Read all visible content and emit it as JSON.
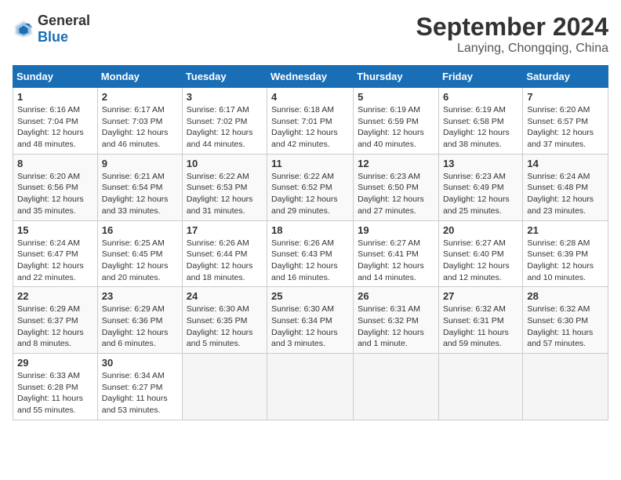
{
  "logo": {
    "general": "General",
    "blue": "Blue"
  },
  "header": {
    "month": "September 2024",
    "location": "Lanying, Chongqing, China"
  },
  "weekdays": [
    "Sunday",
    "Monday",
    "Tuesday",
    "Wednesday",
    "Thursday",
    "Friday",
    "Saturday"
  ],
  "weeks": [
    [
      {
        "day": "1",
        "sunrise": "6:16 AM",
        "sunset": "7:04 PM",
        "daylight": "12 hours and 48 minutes."
      },
      {
        "day": "2",
        "sunrise": "6:17 AM",
        "sunset": "7:03 PM",
        "daylight": "12 hours and 46 minutes."
      },
      {
        "day": "3",
        "sunrise": "6:17 AM",
        "sunset": "7:02 PM",
        "daylight": "12 hours and 44 minutes."
      },
      {
        "day": "4",
        "sunrise": "6:18 AM",
        "sunset": "7:01 PM",
        "daylight": "12 hours and 42 minutes."
      },
      {
        "day": "5",
        "sunrise": "6:19 AM",
        "sunset": "6:59 PM",
        "daylight": "12 hours and 40 minutes."
      },
      {
        "day": "6",
        "sunrise": "6:19 AM",
        "sunset": "6:58 PM",
        "daylight": "12 hours and 38 minutes."
      },
      {
        "day": "7",
        "sunrise": "6:20 AM",
        "sunset": "6:57 PM",
        "daylight": "12 hours and 37 minutes."
      }
    ],
    [
      {
        "day": "8",
        "sunrise": "6:20 AM",
        "sunset": "6:56 PM",
        "daylight": "12 hours and 35 minutes."
      },
      {
        "day": "9",
        "sunrise": "6:21 AM",
        "sunset": "6:54 PM",
        "daylight": "12 hours and 33 minutes."
      },
      {
        "day": "10",
        "sunrise": "6:22 AM",
        "sunset": "6:53 PM",
        "daylight": "12 hours and 31 minutes."
      },
      {
        "day": "11",
        "sunrise": "6:22 AM",
        "sunset": "6:52 PM",
        "daylight": "12 hours and 29 minutes."
      },
      {
        "day": "12",
        "sunrise": "6:23 AM",
        "sunset": "6:50 PM",
        "daylight": "12 hours and 27 minutes."
      },
      {
        "day": "13",
        "sunrise": "6:23 AM",
        "sunset": "6:49 PM",
        "daylight": "12 hours and 25 minutes."
      },
      {
        "day": "14",
        "sunrise": "6:24 AM",
        "sunset": "6:48 PM",
        "daylight": "12 hours and 23 minutes."
      }
    ],
    [
      {
        "day": "15",
        "sunrise": "6:24 AM",
        "sunset": "6:47 PM",
        "daylight": "12 hours and 22 minutes."
      },
      {
        "day": "16",
        "sunrise": "6:25 AM",
        "sunset": "6:45 PM",
        "daylight": "12 hours and 20 minutes."
      },
      {
        "day": "17",
        "sunrise": "6:26 AM",
        "sunset": "6:44 PM",
        "daylight": "12 hours and 18 minutes."
      },
      {
        "day": "18",
        "sunrise": "6:26 AM",
        "sunset": "6:43 PM",
        "daylight": "12 hours and 16 minutes."
      },
      {
        "day": "19",
        "sunrise": "6:27 AM",
        "sunset": "6:41 PM",
        "daylight": "12 hours and 14 minutes."
      },
      {
        "day": "20",
        "sunrise": "6:27 AM",
        "sunset": "6:40 PM",
        "daylight": "12 hours and 12 minutes."
      },
      {
        "day": "21",
        "sunrise": "6:28 AM",
        "sunset": "6:39 PM",
        "daylight": "12 hours and 10 minutes."
      }
    ],
    [
      {
        "day": "22",
        "sunrise": "6:29 AM",
        "sunset": "6:37 PM",
        "daylight": "12 hours and 8 minutes."
      },
      {
        "day": "23",
        "sunrise": "6:29 AM",
        "sunset": "6:36 PM",
        "daylight": "12 hours and 6 minutes."
      },
      {
        "day": "24",
        "sunrise": "6:30 AM",
        "sunset": "6:35 PM",
        "daylight": "12 hours and 5 minutes."
      },
      {
        "day": "25",
        "sunrise": "6:30 AM",
        "sunset": "6:34 PM",
        "daylight": "12 hours and 3 minutes."
      },
      {
        "day": "26",
        "sunrise": "6:31 AM",
        "sunset": "6:32 PM",
        "daylight": "12 hours and 1 minute."
      },
      {
        "day": "27",
        "sunrise": "6:32 AM",
        "sunset": "6:31 PM",
        "daylight": "11 hours and 59 minutes."
      },
      {
        "day": "28",
        "sunrise": "6:32 AM",
        "sunset": "6:30 PM",
        "daylight": "11 hours and 57 minutes."
      }
    ],
    [
      {
        "day": "29",
        "sunrise": "6:33 AM",
        "sunset": "6:28 PM",
        "daylight": "11 hours and 55 minutes."
      },
      {
        "day": "30",
        "sunrise": "6:34 AM",
        "sunset": "6:27 PM",
        "daylight": "11 hours and 53 minutes."
      },
      null,
      null,
      null,
      null,
      null
    ]
  ]
}
